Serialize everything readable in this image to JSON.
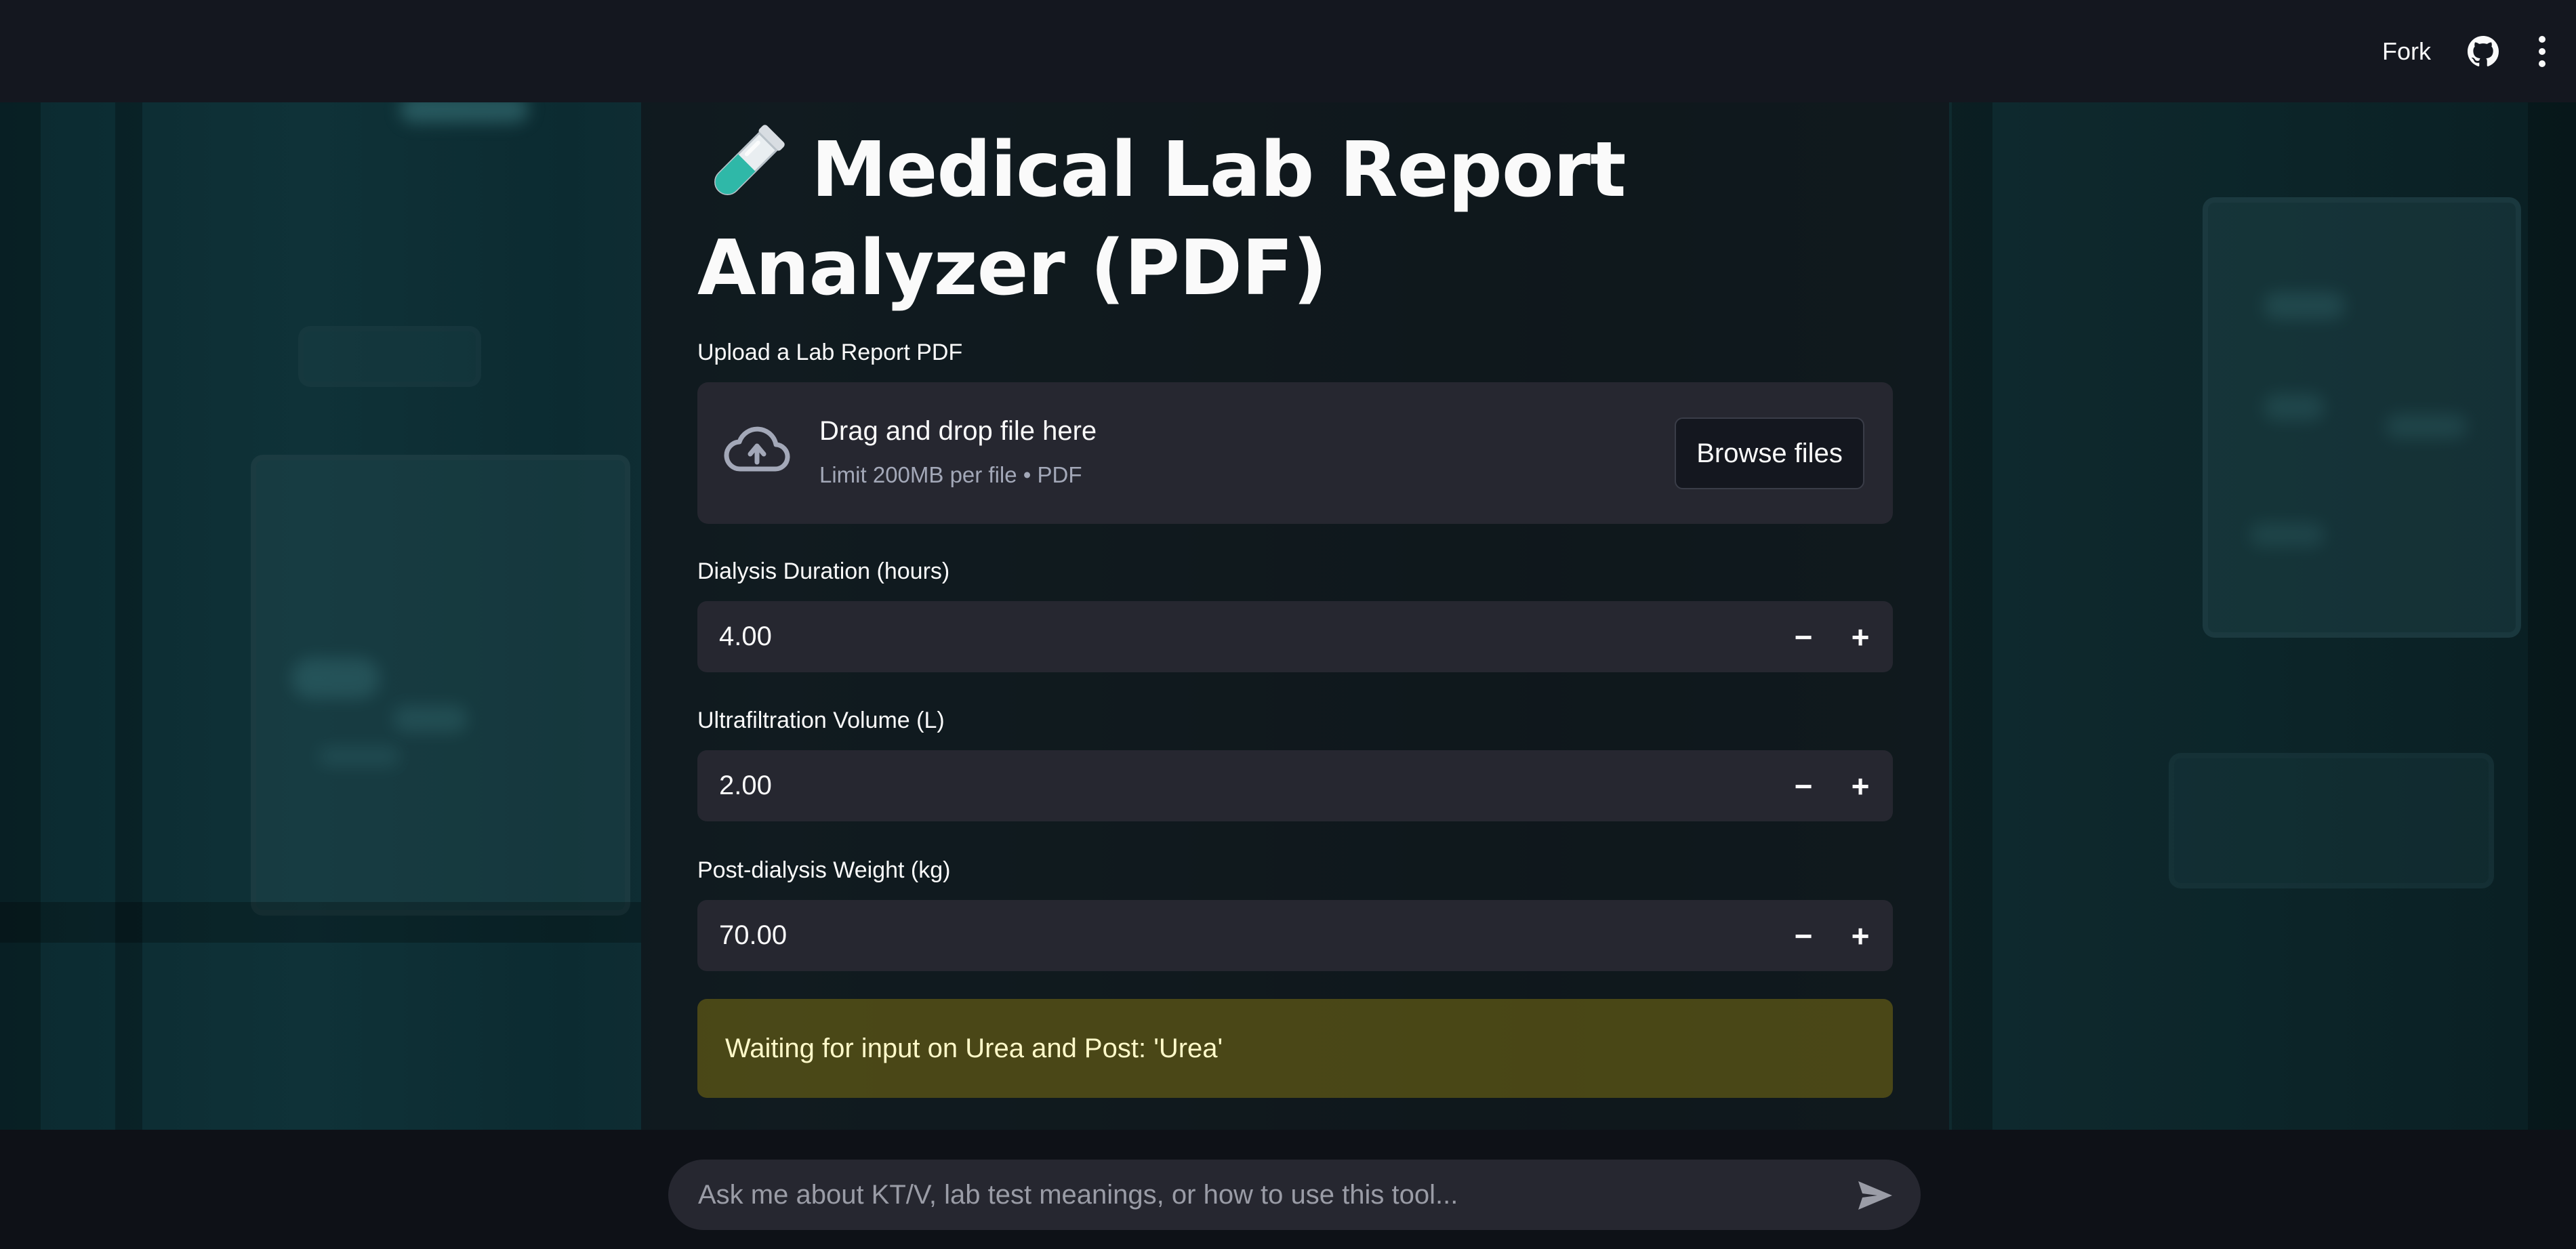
{
  "header": {
    "fork_label": "Fork",
    "github_icon": "github-icon",
    "menu_icon": "kebab-menu-icon"
  },
  "main": {
    "title_icon": "test-tube-icon",
    "title": "Medical Lab Report Analyzer (PDF)",
    "uploader": {
      "label": "Upload a Lab Report PDF",
      "icon": "cloud-upload-icon",
      "drop_text": "Drag and drop file here",
      "limit_text": "Limit 200MB per file • PDF",
      "browse_label": "Browse files"
    },
    "inputs": [
      {
        "label": "Dialysis Duration (hours)",
        "value": "4.00",
        "minus": "−",
        "plus": "+"
      },
      {
        "label": "Ultrafiltration Volume (L)",
        "value": "2.00",
        "minus": "−",
        "plus": "+"
      },
      {
        "label": "Post-dialysis Weight (kg)",
        "value": "70.00",
        "minus": "−",
        "plus": "+"
      }
    ],
    "alert": "Waiting for input on Urea and Post: 'Urea'"
  },
  "chat": {
    "placeholder": "Ask me about KT/V, lab test meanings, or how to use this tool...",
    "send_icon": "send-icon"
  },
  "colors": {
    "background": "#0e1117",
    "widget": "#262730",
    "alert_bg": "#6e6414",
    "alert_text": "#fff9c9",
    "accent_teal": "#2fb8a8"
  }
}
